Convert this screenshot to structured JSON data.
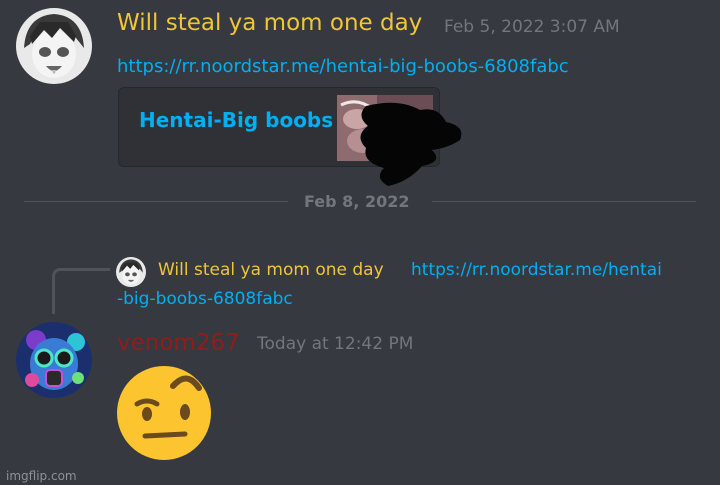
{
  "message1": {
    "author": "Will steal ya mom one day",
    "timestamp": "Feb 5, 2022 3:07 AM",
    "link": "https://rr.noordstar.me/hentai-big-boobs-6808fabc",
    "embed": {
      "title": "Hentai-Big boobs"
    }
  },
  "divider": {
    "date": "Feb 8, 2022"
  },
  "reply": {
    "author": "Will steal ya mom one day",
    "link_line1": "https://rr.noordstar.me/hentai",
    "link_line2": "-big-boobs-6808fabc"
  },
  "message2": {
    "author": "venom267",
    "timestamp": "Today at 12:42 PM",
    "emoji": "face-with-raised-eyebrow"
  },
  "watermark": "imgflip.com",
  "colors": {
    "background": "#36393f",
    "link": "#00aff4",
    "username_yellow": "#f0c53a",
    "username_red": "#8f1d1d",
    "timestamp": "#72767d"
  }
}
